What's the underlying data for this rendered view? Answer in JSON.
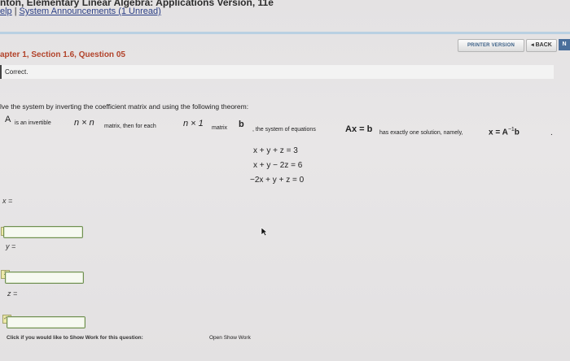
{
  "header": {
    "book_title": "nton, Elementary Linear Algebra: Applications Version, 11e",
    "help_link": "elp",
    "separator": "|",
    "announcements_link": "System Announcements (1 Unread)"
  },
  "toolbar": {
    "printer_version": "PRINTER VERSION",
    "back": "◂ BACK",
    "next": "N"
  },
  "section_title": "apter 1, Section 1.6, Question 05",
  "status": "Correct.",
  "instructions": "lve the system by inverting the coefficient matrix and using the following theorem:",
  "theorem": {
    "A": "A",
    "t1": "is an invertible",
    "nxn": "n × n",
    "t2": "matrix, then for each",
    "nx1": "n × 1",
    "t3": "matrix",
    "b": "b",
    "t4": ", the system of equations",
    "Axb": "Ax = b",
    "t5": "has exactly one solution, namely,",
    "sol": "x = A",
    "exp": "−1",
    "solb": "b",
    "period": "."
  },
  "equations": [
    "x + y + z = 3",
    "x + y − 2z = 6",
    "−2x + y + z = 0"
  ],
  "answers": {
    "x_label": "x =",
    "y_label": "y =",
    "z_label": "z =",
    "x_marker": "1",
    "y_marker": "2",
    "z_marker": "✓1"
  },
  "footer": {
    "prompt": "Click if you would like to Show Work for this question:",
    "link": "Open Show Work"
  }
}
